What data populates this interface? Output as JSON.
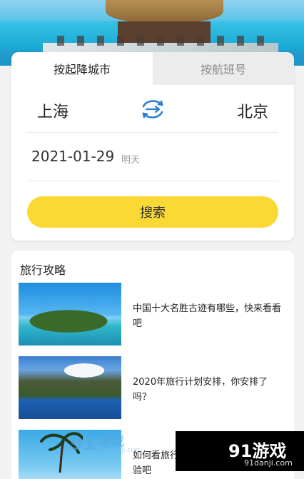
{
  "tabs": [
    {
      "label": "按起降城市",
      "active": true
    },
    {
      "label": "按航班号",
      "active": false
    }
  ],
  "route": {
    "from": "上海",
    "to": "北京",
    "swap_icon": "airplane-swap-icon"
  },
  "date": {
    "value": "2021-01-29",
    "hint": "明天"
  },
  "search_button": "搜索",
  "guide": {
    "title": "旅行攻略",
    "articles": [
      {
        "title": "中国十大名胜古迹有哪些，快来看看吧"
      },
      {
        "title": "2020年旅行计划安排，你安排了吗？"
      },
      {
        "title": "如何看旅行社的",
        "title_cut": "验吧"
      }
    ]
  },
  "watermark": {
    "brand": "91游戏",
    "url": "91danji.com",
    "left_brand": "游戏",
    "left_url": "91danji.com"
  },
  "colors": {
    "accent": "#fbd934",
    "swap_icon": "#2a7fd4"
  }
}
